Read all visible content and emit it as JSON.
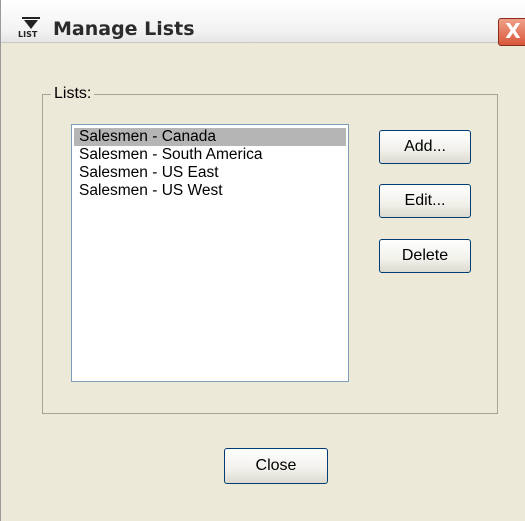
{
  "window": {
    "title": "Manage Lists",
    "icon_label": "LIST",
    "close_glyph": "X"
  },
  "group": {
    "label": "Lists:"
  },
  "lists": {
    "items": [
      {
        "label": "Salesmen - Canada",
        "selected": true
      },
      {
        "label": "Salesmen - South America",
        "selected": false
      },
      {
        "label": "Salesmen - US East",
        "selected": false
      },
      {
        "label": "Salesmen - US West",
        "selected": false
      }
    ]
  },
  "buttons": {
    "add": "Add...",
    "edit": "Edit...",
    "delete": "Delete",
    "close": "Close"
  }
}
